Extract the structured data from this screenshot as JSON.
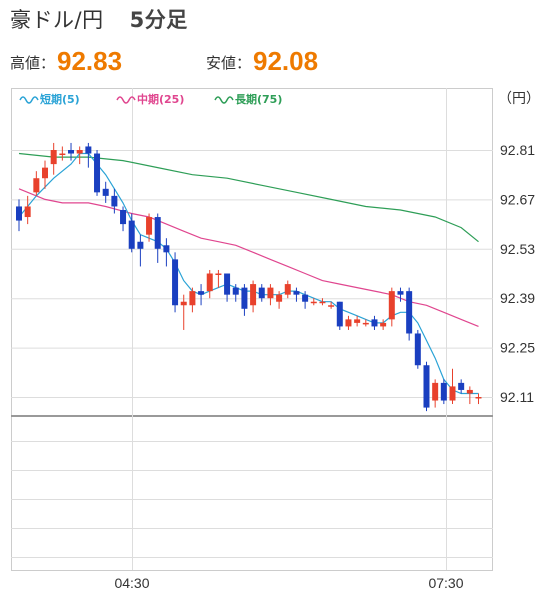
{
  "header": {
    "pair": "豪ドル/円",
    "interval": "5分足",
    "high_label": "高値：",
    "high_value": "92.83",
    "low_label": "安値：",
    "low_value": "92.08"
  },
  "chart_data": {
    "type": "candlestick",
    "unit_label": "（円）",
    "y_ticks": [
      "92.81",
      "92.67",
      "92.53",
      "92.39",
      "92.25",
      "92.11"
    ],
    "x_ticks": [
      "04:30",
      "07:30"
    ],
    "ylim": [
      92.05,
      92.85
    ],
    "legend": [
      {
        "name": "短期(5)",
        "color": "#2aa3d6"
      },
      {
        "name": "中期(25)",
        "color": "#e0468f"
      },
      {
        "name": "長期(75)",
        "color": "#2e9e57"
      }
    ],
    "colors": {
      "up": "#e8412c",
      "down": "#1a3fc0",
      "grid": "#dddddd",
      "frame": "#cccccc"
    },
    "candles": [
      [
        92.65,
        92.61,
        92.67,
        92.58
      ],
      [
        92.62,
        92.65,
        92.68,
        92.6
      ],
      [
        92.69,
        92.73,
        92.75,
        92.68
      ],
      [
        92.73,
        92.76,
        92.78,
        92.7
      ],
      [
        92.77,
        92.81,
        92.83,
        92.74
      ],
      [
        92.8,
        92.8,
        92.82,
        92.78
      ],
      [
        92.81,
        92.8,
        92.83,
        92.78
      ],
      [
        92.8,
        92.81,
        92.82,
        92.77
      ],
      [
        92.82,
        92.8,
        92.83,
        92.76
      ],
      [
        92.8,
        92.69,
        92.81,
        92.68
      ],
      [
        92.7,
        92.68,
        92.72,
        92.66
      ],
      [
        92.68,
        92.65,
        92.7,
        92.63
      ],
      [
        92.64,
        92.6,
        92.65,
        92.58
      ],
      [
        92.61,
        92.53,
        92.63,
        92.52
      ],
      [
        92.55,
        92.53,
        92.57,
        92.48
      ],
      [
        92.57,
        92.62,
        92.63,
        92.55
      ],
      [
        92.62,
        92.53,
        92.63,
        92.49
      ],
      [
        92.54,
        92.52,
        92.56,
        92.48
      ],
      [
        92.5,
        92.37,
        92.52,
        92.35
      ],
      [
        92.37,
        92.38,
        92.4,
        92.3
      ],
      [
        92.37,
        92.41,
        92.42,
        92.35
      ],
      [
        92.41,
        92.4,
        92.43,
        92.37
      ],
      [
        92.41,
        92.46,
        92.47,
        92.39
      ],
      [
        92.46,
        92.46,
        92.47,
        92.42
      ],
      [
        92.46,
        92.4,
        92.46,
        92.38
      ],
      [
        92.42,
        92.4,
        92.43,
        92.38
      ],
      [
        92.42,
        92.36,
        92.43,
        92.34
      ],
      [
        92.37,
        92.43,
        92.44,
        92.35
      ],
      [
        92.42,
        92.39,
        92.43,
        92.38
      ],
      [
        92.39,
        92.42,
        92.43,
        92.37
      ],
      [
        92.38,
        92.4,
        92.41,
        92.36
      ],
      [
        92.4,
        92.43,
        92.44,
        92.39
      ],
      [
        92.41,
        92.4,
        92.42,
        92.38
      ],
      [
        92.4,
        92.38,
        92.41,
        92.36
      ],
      [
        92.38,
        92.38,
        92.39,
        92.37
      ],
      [
        92.38,
        92.38,
        92.39,
        92.37
      ],
      [
        92.37,
        92.37,
        92.38,
        92.36
      ],
      [
        92.38,
        92.31,
        92.38,
        92.3
      ],
      [
        92.31,
        92.33,
        92.34,
        92.3
      ],
      [
        92.32,
        92.33,
        92.34,
        92.31
      ],
      [
        92.32,
        92.32,
        92.33,
        92.31
      ],
      [
        92.33,
        92.31,
        92.34,
        92.3
      ],
      [
        92.31,
        92.32,
        92.33,
        92.3
      ],
      [
        92.33,
        92.41,
        92.42,
        92.31
      ],
      [
        92.41,
        92.4,
        92.42,
        92.38
      ],
      [
        92.41,
        92.29,
        92.42,
        92.27
      ],
      [
        92.29,
        92.2,
        92.3,
        92.19
      ],
      [
        92.2,
        92.08,
        92.21,
        92.07
      ],
      [
        92.1,
        92.15,
        92.16,
        92.08
      ],
      [
        92.15,
        92.1,
        92.16,
        92.09
      ],
      [
        92.1,
        92.14,
        92.19,
        92.09
      ],
      [
        92.15,
        92.13,
        92.16,
        92.12
      ],
      [
        92.12,
        92.13,
        92.14,
        92.09
      ],
      [
        92.11,
        92.11,
        92.12,
        92.09
      ]
    ],
    "ma_short": [
      [
        0,
        92.62
      ],
      [
        2,
        92.68
      ],
      [
        4,
        92.73
      ],
      [
        6,
        92.77
      ],
      [
        7,
        92.8
      ],
      [
        8,
        92.8
      ],
      [
        9,
        92.77
      ],
      [
        10,
        92.74
      ],
      [
        11,
        92.7
      ],
      [
        12,
        92.66
      ],
      [
        13,
        92.61
      ],
      [
        14,
        92.57
      ],
      [
        15,
        92.56
      ],
      [
        16,
        92.55
      ],
      [
        17,
        92.53
      ],
      [
        18,
        92.49
      ],
      [
        19,
        92.44
      ],
      [
        20,
        92.41
      ],
      [
        21,
        92.4
      ],
      [
        22,
        92.41
      ],
      [
        23,
        92.42
      ],
      [
        24,
        92.43
      ],
      [
        25,
        92.42
      ],
      [
        26,
        92.41
      ],
      [
        27,
        92.41
      ],
      [
        28,
        92.4
      ],
      [
        29,
        92.4
      ],
      [
        30,
        92.4
      ],
      [
        31,
        92.41
      ],
      [
        32,
        92.41
      ],
      [
        33,
        92.4
      ],
      [
        34,
        92.39
      ],
      [
        35,
        92.38
      ],
      [
        36,
        92.38
      ],
      [
        37,
        92.36
      ],
      [
        38,
        92.35
      ],
      [
        39,
        92.34
      ],
      [
        40,
        92.33
      ],
      [
        41,
        92.32
      ],
      [
        42,
        92.32
      ],
      [
        43,
        92.34
      ],
      [
        44,
        92.35
      ],
      [
        45,
        92.35
      ],
      [
        46,
        92.32
      ],
      [
        47,
        92.27
      ],
      [
        48,
        92.22
      ],
      [
        49,
        92.16
      ],
      [
        50,
        92.13
      ],
      [
        51,
        92.12
      ],
      [
        52,
        92.12
      ],
      [
        53,
        92.12
      ]
    ],
    "ma_mid": [
      [
        0,
        92.7
      ],
      [
        3,
        92.67
      ],
      [
        5,
        92.66
      ],
      [
        8,
        92.66
      ],
      [
        10,
        92.65
      ],
      [
        13,
        92.63
      ],
      [
        15,
        92.62
      ],
      [
        17,
        92.6
      ],
      [
        19,
        92.58
      ],
      [
        21,
        92.56
      ],
      [
        23,
        92.55
      ],
      [
        25,
        92.54
      ],
      [
        27,
        92.52
      ],
      [
        29,
        92.5
      ],
      [
        31,
        92.48
      ],
      [
        33,
        92.46
      ],
      [
        35,
        92.44
      ],
      [
        37,
        92.43
      ],
      [
        39,
        92.42
      ],
      [
        41,
        92.41
      ],
      [
        43,
        92.4
      ],
      [
        45,
        92.38
      ],
      [
        47,
        92.37
      ],
      [
        49,
        92.35
      ],
      [
        51,
        92.33
      ],
      [
        53,
        92.31
      ]
    ],
    "ma_long": [
      [
        0,
        92.8
      ],
      [
        4,
        92.79
      ],
      [
        8,
        92.79
      ],
      [
        12,
        92.78
      ],
      [
        16,
        92.76
      ],
      [
        20,
        92.74
      ],
      [
        24,
        92.73
      ],
      [
        28,
        92.71
      ],
      [
        32,
        92.69
      ],
      [
        36,
        92.67
      ],
      [
        40,
        92.65
      ],
      [
        44,
        92.64
      ],
      [
        48,
        92.62
      ],
      [
        51,
        92.59
      ],
      [
        53,
        92.55
      ]
    ]
  }
}
